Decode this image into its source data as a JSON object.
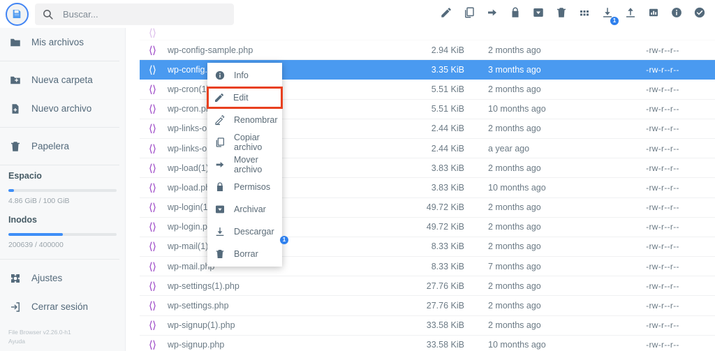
{
  "header": {
    "logo_icon": "floppy-disk-icon",
    "search": {
      "placeholder": "Buscar...",
      "value": "",
      "icon": "search-icon"
    },
    "toolbar": [
      {
        "name": "edit-button",
        "icon": "pencil-icon",
        "badge": ""
      },
      {
        "name": "copy-button",
        "icon": "copy-icon",
        "badge": ""
      },
      {
        "name": "move-button",
        "icon": "arrow-right-icon",
        "badge": ""
      },
      {
        "name": "permissions-button",
        "icon": "lock-icon",
        "badge": ""
      },
      {
        "name": "archive-button",
        "icon": "archive-icon",
        "badge": ""
      },
      {
        "name": "delete-button",
        "icon": "trash-icon",
        "badge": ""
      },
      {
        "name": "grid-view-button",
        "icon": "grid-icon",
        "badge": ""
      },
      {
        "name": "download-button",
        "icon": "download-icon",
        "badge": "1"
      },
      {
        "name": "upload-button",
        "icon": "upload-icon",
        "badge": ""
      },
      {
        "name": "stats-button",
        "icon": "chart-icon",
        "badge": ""
      },
      {
        "name": "info-button",
        "icon": "info-icon",
        "badge": ""
      },
      {
        "name": "select-all-button",
        "icon": "check-circle-icon",
        "badge": ""
      }
    ]
  },
  "sidebar": {
    "items": [
      {
        "label": "Mis archivos",
        "icon": "folder-icon"
      },
      {
        "label": "Nueva carpeta",
        "icon": "folder-plus-icon"
      },
      {
        "label": "Nuevo archivo",
        "icon": "file-plus-icon"
      },
      {
        "label": "Papelera",
        "icon": "trash-icon"
      }
    ],
    "usage": [
      {
        "title": "Espacio",
        "label": "4.86 GiB / 100 GiB",
        "percent": 5
      },
      {
        "title": "Inodos",
        "label": "200639 / 400000",
        "percent": 50
      }
    ],
    "bottom_items": [
      {
        "label": "Ajustes",
        "icon": "gear-icon"
      },
      {
        "label": "Cerrar sesión",
        "icon": "logout-icon"
      }
    ],
    "footer": {
      "version": "File Browser v2.26.0-h1",
      "help": "Ayuda"
    }
  },
  "files": [
    {
      "name": "",
      "size": "",
      "date": "",
      "perms": "",
      "selected": false,
      "clipped": true
    },
    {
      "name": "wp-config-sample.php",
      "size": "2.94 KiB",
      "date": "2 months ago",
      "perms": "-rw-r--r--",
      "selected": false
    },
    {
      "name": "wp-config.php",
      "size": "3.35 KiB",
      "date": "3 months ago",
      "perms": "-rw-r--r--",
      "selected": true
    },
    {
      "name": "wp-cron(1).php",
      "size": "5.51 KiB",
      "date": "2 months ago",
      "perms": "-rw-r--r--",
      "selected": false
    },
    {
      "name": "wp-cron.php",
      "size": "5.51 KiB",
      "date": "10 months ago",
      "perms": "-rw-r--r--",
      "selected": false
    },
    {
      "name": "wp-links-opml(1).php",
      "size": "2.44 KiB",
      "date": "2 months ago",
      "perms": "-rw-r--r--",
      "selected": false
    },
    {
      "name": "wp-links-opml.php",
      "size": "2.44 KiB",
      "date": "a year ago",
      "perms": "-rw-r--r--",
      "selected": false
    },
    {
      "name": "wp-load(1).php",
      "size": "3.83 KiB",
      "date": "2 months ago",
      "perms": "-rw-r--r--",
      "selected": false
    },
    {
      "name": "wp-load.php",
      "size": "3.83 KiB",
      "date": "10 months ago",
      "perms": "-rw-r--r--",
      "selected": false
    },
    {
      "name": "wp-login(1).php",
      "size": "49.72 KiB",
      "date": "2 months ago",
      "perms": "-rw-r--r--",
      "selected": false
    },
    {
      "name": "wp-login.php",
      "size": "49.72 KiB",
      "date": "2 months ago",
      "perms": "-rw-r--r--",
      "selected": false
    },
    {
      "name": "wp-mail(1).php",
      "size": "8.33 KiB",
      "date": "2 months ago",
      "perms": "-rw-r--r--",
      "selected": false
    },
    {
      "name": "wp-mail.php",
      "size": "8.33 KiB",
      "date": "7 months ago",
      "perms": "-rw-r--r--",
      "selected": false
    },
    {
      "name": "wp-settings(1).php",
      "size": "27.76 KiB",
      "date": "2 months ago",
      "perms": "-rw-r--r--",
      "selected": false
    },
    {
      "name": "wp-settings.php",
      "size": "27.76 KiB",
      "date": "2 months ago",
      "perms": "-rw-r--r--",
      "selected": false
    },
    {
      "name": "wp-signup(1).php",
      "size": "33.58 KiB",
      "date": "2 months ago",
      "perms": "-rw-r--r--",
      "selected": false
    },
    {
      "name": "wp-signup.php",
      "size": "33.58 KiB",
      "date": "10 months ago",
      "perms": "-rw-r--r--",
      "selected": false
    }
  ],
  "context_menu": {
    "items": [
      {
        "label": "Info",
        "icon": "info-icon",
        "highlighted": false,
        "badge": ""
      },
      {
        "label": "Edit",
        "icon": "pencil-icon",
        "highlighted": true,
        "badge": ""
      },
      {
        "label": "Renombrar",
        "icon": "rename-icon",
        "highlighted": false,
        "badge": ""
      },
      {
        "label": "Copiar archivo",
        "icon": "copy-icon",
        "highlighted": false,
        "badge": ""
      },
      {
        "label": "Mover archivo",
        "icon": "arrow-right-icon",
        "highlighted": false,
        "badge": ""
      },
      {
        "label": "Permisos",
        "icon": "lock-icon",
        "highlighted": false,
        "badge": ""
      },
      {
        "label": "Archivar",
        "icon": "archive-icon",
        "highlighted": false,
        "badge": ""
      },
      {
        "label": "Descargar",
        "icon": "download-icon",
        "highlighted": false,
        "badge": "1"
      },
      {
        "label": "Borrar",
        "icon": "trash-icon",
        "highlighted": false,
        "badge": ""
      }
    ]
  },
  "colors": {
    "accent": "#4a9af0",
    "highlight_border": "#e8401f",
    "code_icon": "#9b45c6",
    "text": "#546a7b"
  }
}
